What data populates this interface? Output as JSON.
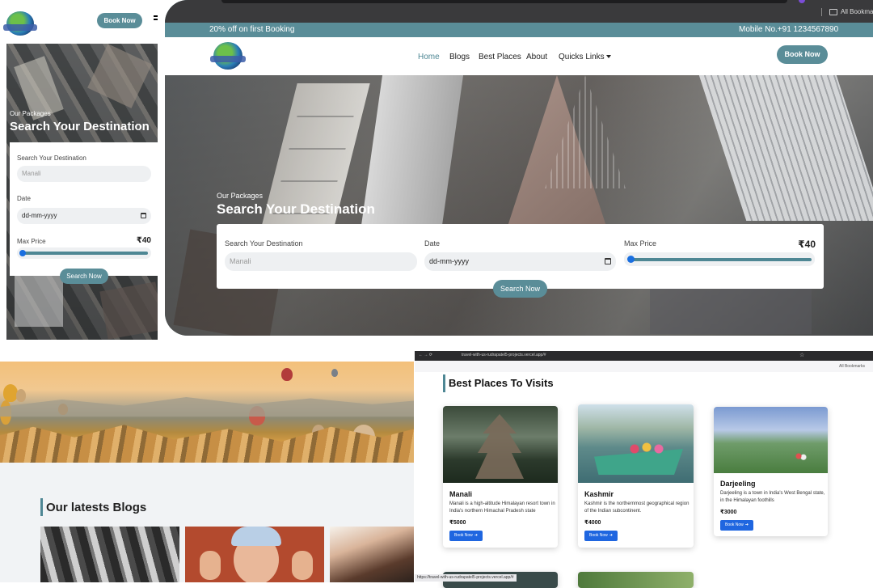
{
  "mobile": {
    "book_label": "Book Now",
    "hero_subtitle": "Our Packages",
    "hero_title": "Search Your Destination",
    "form": {
      "destination_label": "Search Your Destination",
      "destination_placeholder": "Manali",
      "date_label": "Date",
      "date_value": "dd-mm-yyyy",
      "price_label": "Max Price",
      "price_value": "₹40",
      "price_slider_fraction": 0.0
    },
    "search_label": "Search Now"
  },
  "desktop": {
    "bookmarks_label": "All Bookmarks",
    "promo_text": "20% off on first Booking",
    "mobile_text": "Mobile No.+91 1234567890",
    "nav": {
      "home": "Home",
      "blogs": "Blogs",
      "best_places": "Best Places",
      "about": "About",
      "quick_links": "Quicks Links"
    },
    "book_label": "Book Now",
    "hero_subtitle": "Our Packages",
    "hero_title": "Search Your Destination",
    "form": {
      "destination_label": "Search Your Destination",
      "destination_placeholder": "Manali",
      "date_label": "Date",
      "date_value": "dd-mm-yyyy",
      "price_label": "Max Price",
      "price_value": "₹40",
      "price_slider_fraction": 0.0
    },
    "search_label": "Search Now"
  },
  "blogs": {
    "title": "Our latests Blogs"
  },
  "places": {
    "browser_url": "travel-with-us-rudrapatel5-projects.vercel.app/#",
    "bookmarks_label": "All Bookmarks",
    "title": "Best Places To Visits",
    "cards": [
      {
        "name": "Manali",
        "desc": "Manali is a high-altitude Himalayan resort town in India's northern Himachal Pradesh state",
        "price": "₹5000",
        "button": "Book Now"
      },
      {
        "name": "Kashmir",
        "desc": "Kashmir is the northernmost geographical region of the Indian subcontinent.",
        "price": "₹4000",
        "button": "Book Now"
      },
      {
        "name": "Darjeeling",
        "desc": "Darjeeling is a town in India's West Bengal state, in the Himalayan foothills",
        "price": "₹3000",
        "button": "Book Now"
      }
    ],
    "status_url": "https://travel-with-us-rudrapatel5-projects.vercel.app/#"
  },
  "colors": {
    "accent": "#5a8d98",
    "slider": "#4e8794",
    "thumb": "#1a6fe0",
    "card_button": "#1f66e0"
  }
}
